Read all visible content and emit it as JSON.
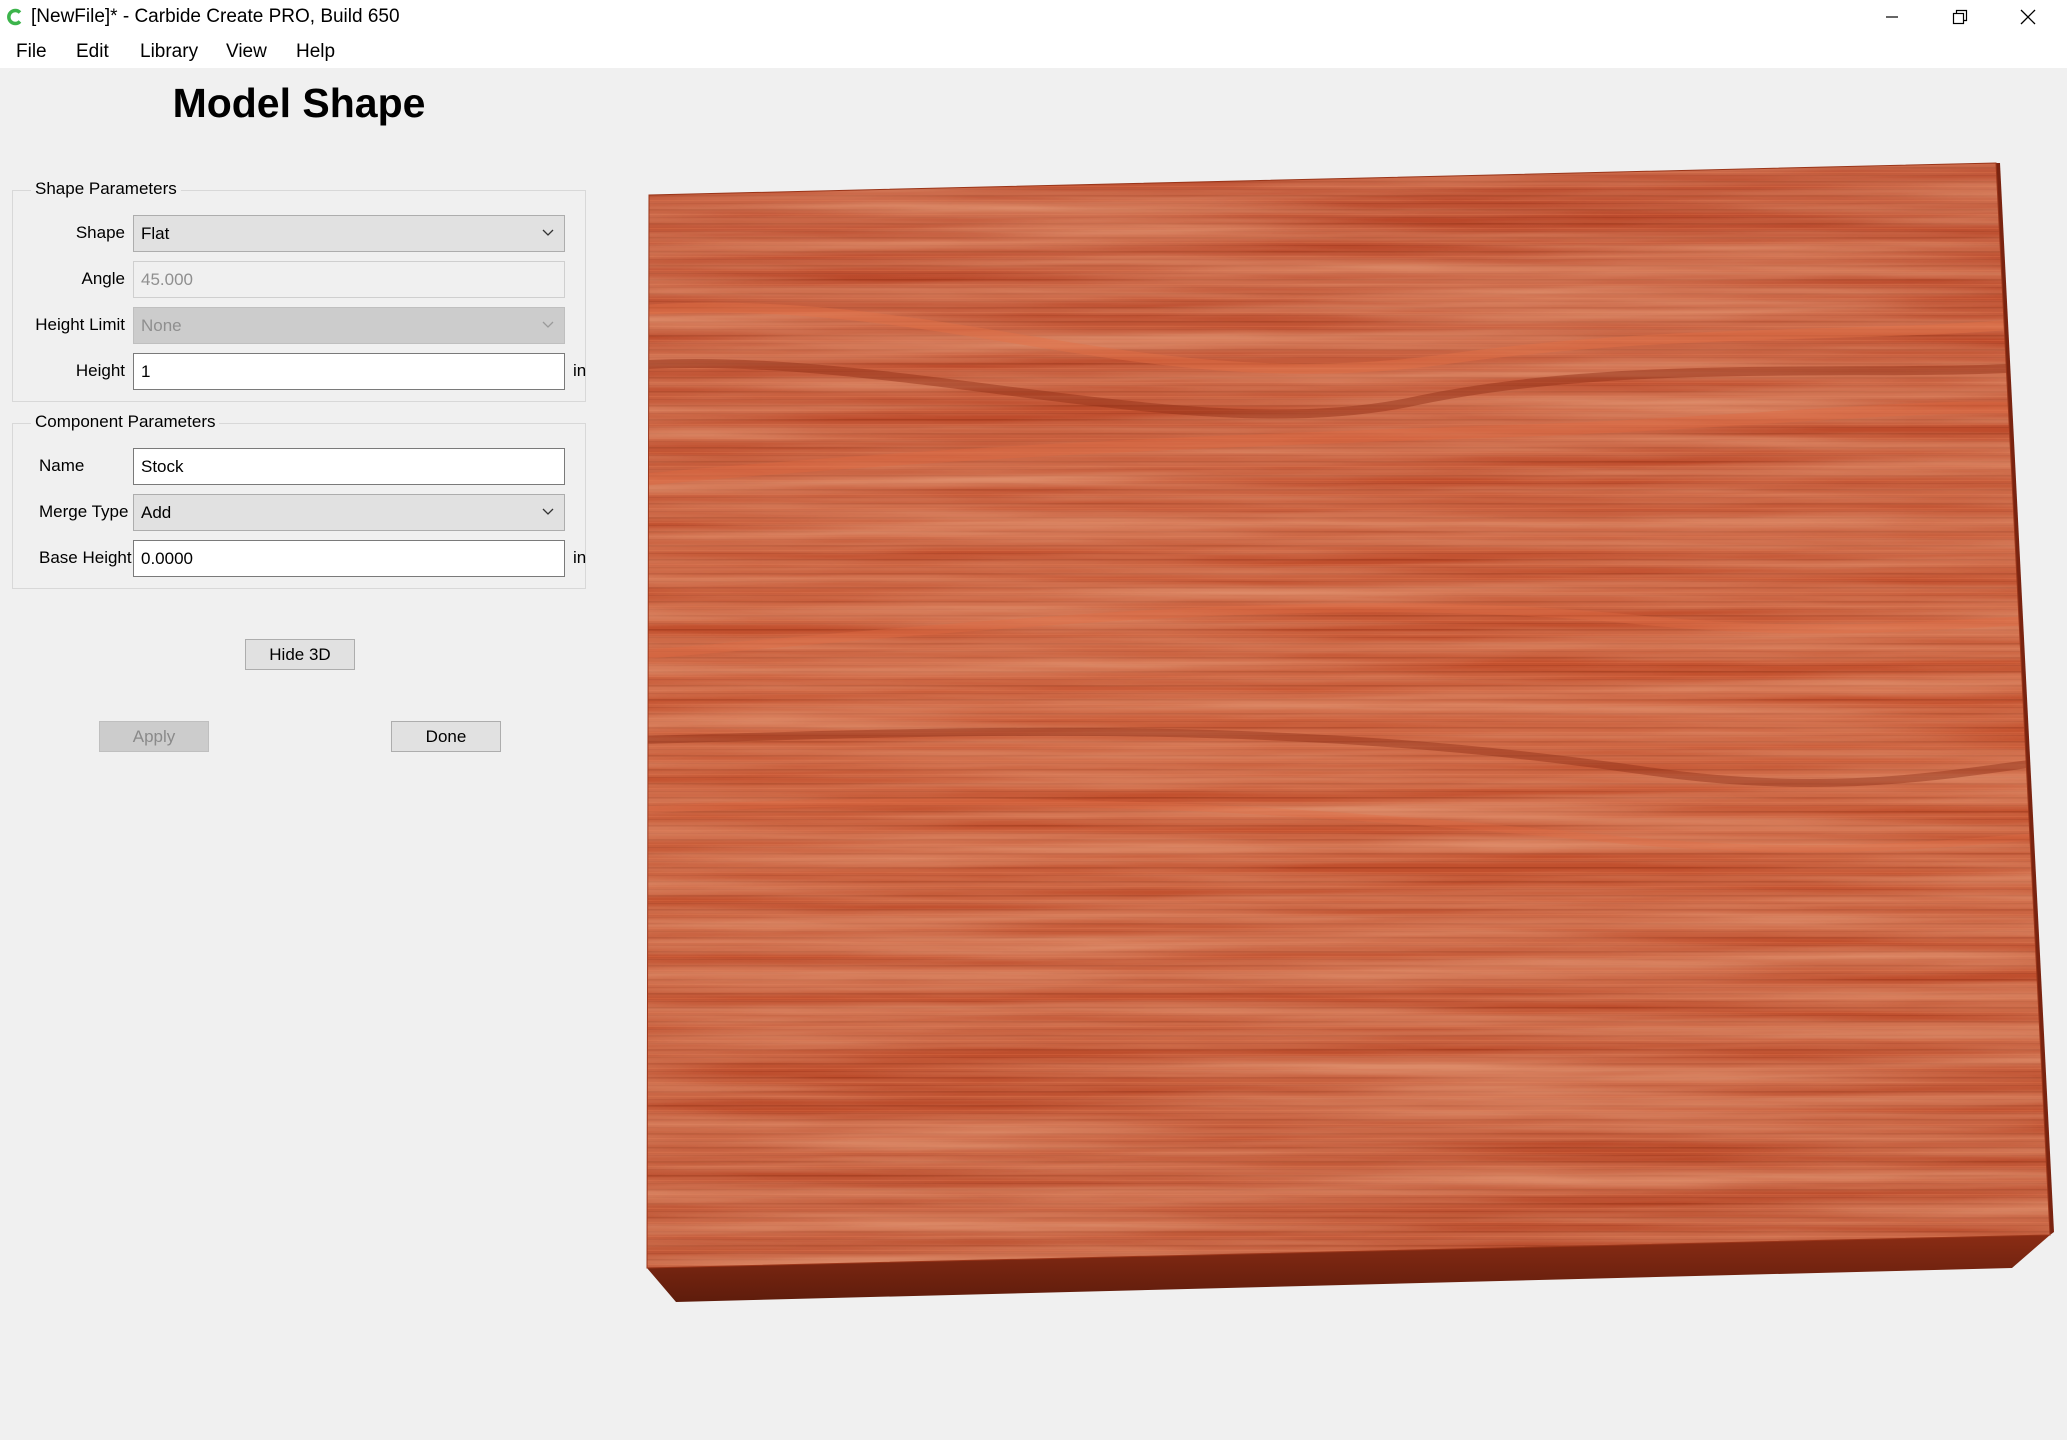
{
  "window": {
    "title": "[NewFile]* - Carbide Create PRO, Build 650",
    "controls": [
      "minimize-icon",
      "restore-icon",
      "close-icon"
    ]
  },
  "menu": {
    "file": "File",
    "edit": "Edit",
    "library": "Library",
    "view": "View",
    "help": "Help"
  },
  "page": {
    "title": "Model Shape"
  },
  "shape_params": {
    "title": "Shape Parameters",
    "shape_label": "Shape",
    "shape_value": "Flat",
    "angle_label": "Angle",
    "angle_value": "45.000",
    "height_limit_label": "Height Limit",
    "height_limit_value": "None",
    "height_label": "Height",
    "height_value": "1",
    "height_unit": "in"
  },
  "component_params": {
    "title": "Component Parameters",
    "name_label": "Name",
    "name_value": "Stock",
    "merge_type_label": "Merge Type",
    "merge_type_value": "Add",
    "base_height_label": "Base Height",
    "base_height_value": "0.0000",
    "base_height_unit": "in"
  },
  "buttons": {
    "hide_3d": "Hide 3D",
    "apply": "Apply",
    "done": "Done"
  },
  "colors": {
    "wood_top": "#c2502e",
    "wood_dark": "#8f2d14",
    "wood_light": "#e06a42",
    "app_icon": "#3cb44b"
  }
}
